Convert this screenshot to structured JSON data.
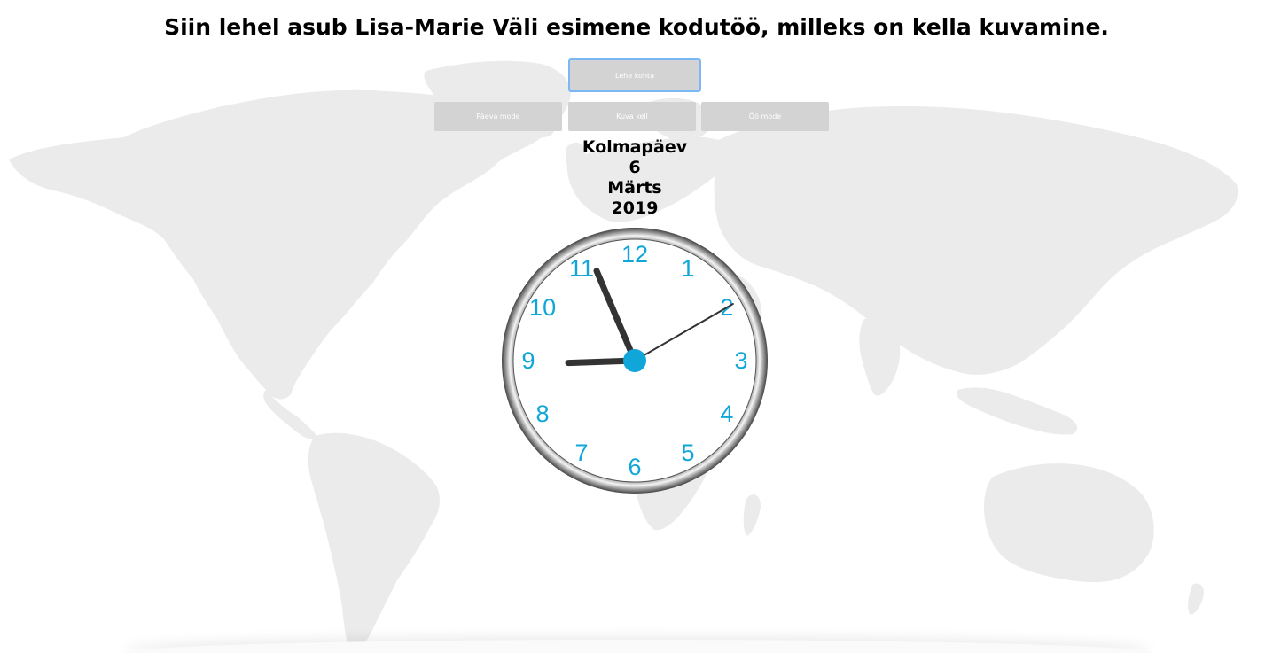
{
  "page": {
    "title": "Siin lehel asub Lisa-Marie Väli esimene kodutöö, milleks on kella kuvamine."
  },
  "buttons": {
    "about": "Lehe kohta",
    "day_mode": "Päeva mode",
    "show_clock": "Kuva kell",
    "night_mode": "Öö mode"
  },
  "date": {
    "weekday": "Kolmapäev",
    "day": "6",
    "month": "Märts",
    "year": "2019"
  },
  "clock": {
    "numbers": [
      "12",
      "1",
      "2",
      "3",
      "4",
      "5",
      "6",
      "7",
      "8",
      "9",
      "10",
      "11"
    ],
    "time": {
      "hours": 8,
      "minutes": 56,
      "seconds": 10
    },
    "number_color": "#11a6d9",
    "hand_color": "#333333",
    "center_color": "#11a6d9"
  },
  "colors": {
    "map_land": "#ebebeb",
    "button_bg": "#d3d3d3",
    "button_focus_border": "#7ab8f5"
  }
}
